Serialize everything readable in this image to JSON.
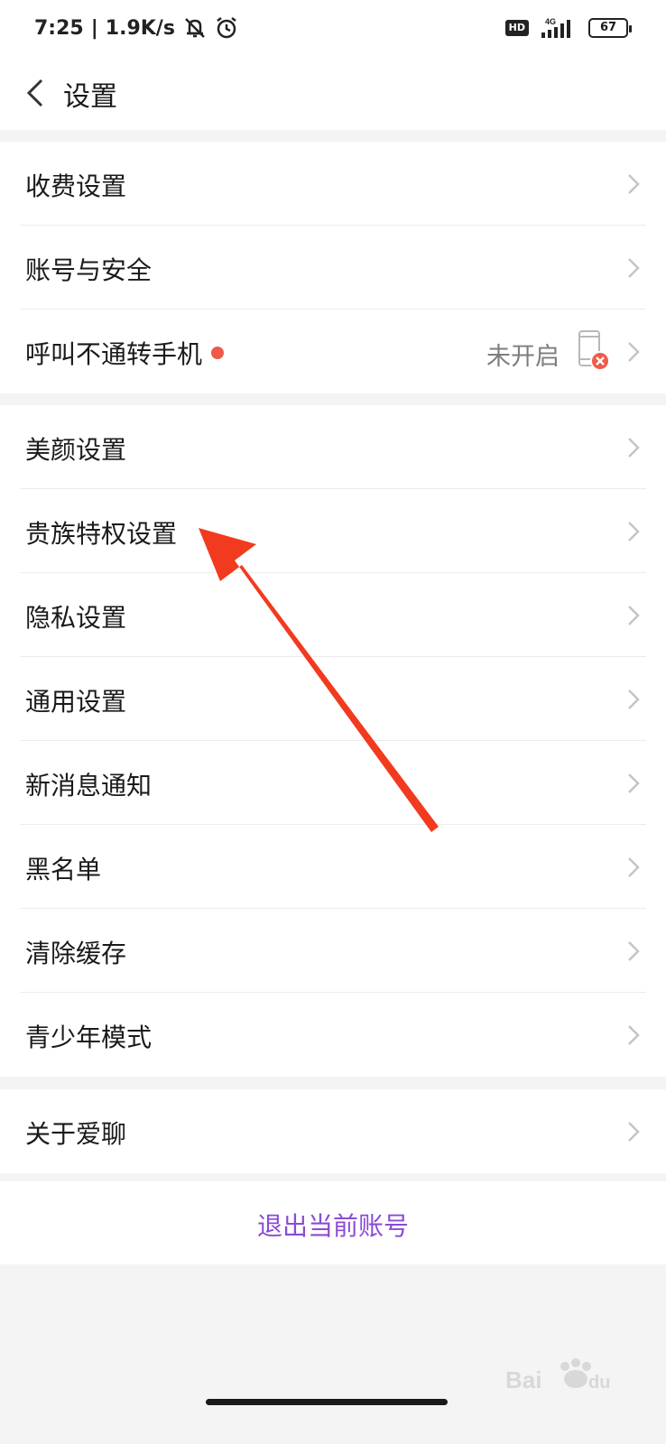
{
  "status_bar": {
    "time": "7:25",
    "speed": "1.9K/s",
    "hd": "HD",
    "network": "4G",
    "battery": "67"
  },
  "header": {
    "back_icon": "chevron-left-icon",
    "title": "设置"
  },
  "group1": [
    {
      "label": "收费设置"
    },
    {
      "label": "账号与安全"
    },
    {
      "label": "呼叫不通转手机",
      "status": "未开启",
      "has_dot": true
    }
  ],
  "group2": [
    {
      "label": "美颜设置"
    },
    {
      "label": "贵族特权设置"
    },
    {
      "label": "隐私设置"
    },
    {
      "label": "通用设置"
    },
    {
      "label": "新消息通知"
    },
    {
      "label": "黑名单"
    },
    {
      "label": "清除缓存"
    },
    {
      "label": "青少年模式"
    }
  ],
  "group3": [
    {
      "label": "关于爱聊"
    }
  ],
  "logout": {
    "label": "退出当前账号"
  },
  "colors": {
    "accent": "#8a4bd6",
    "dot": "#f05a4a",
    "annotation_arrow": "#f23a1e"
  }
}
